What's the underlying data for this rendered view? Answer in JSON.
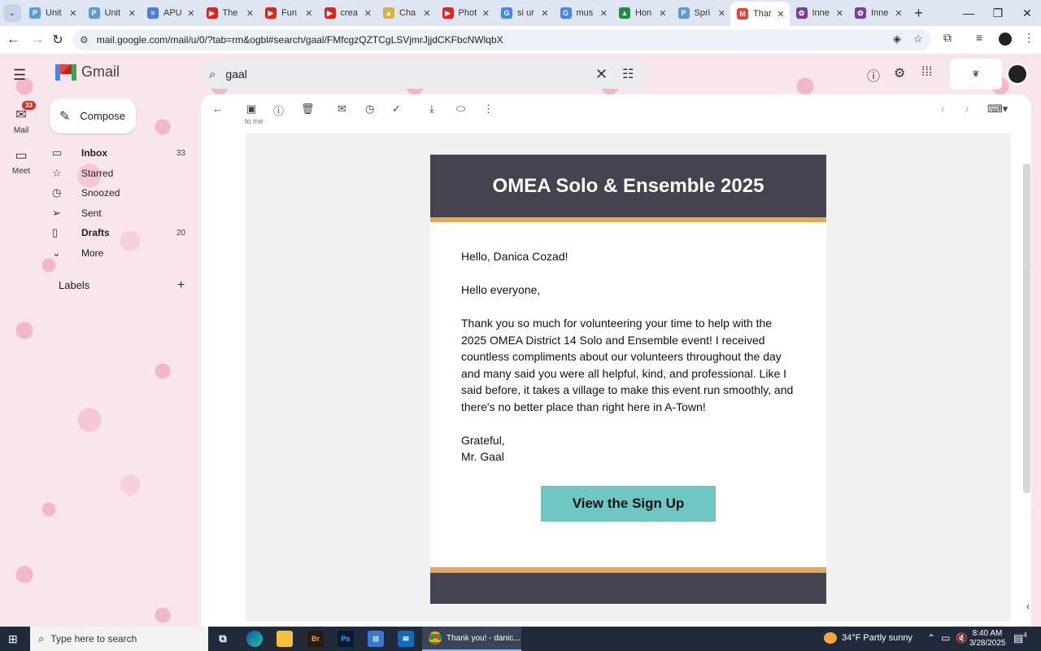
{
  "browser": {
    "tabs": [
      {
        "label": "Unit",
        "fav": "P",
        "color": "#5b9bd5"
      },
      {
        "label": "Unit",
        "fav": "P",
        "color": "#5b9bd5"
      },
      {
        "label": "APU",
        "fav": "≡",
        "color": "#4a7fd8"
      },
      {
        "label": "The",
        "fav": "▶",
        "color": "#e62117"
      },
      {
        "label": "Fun",
        "fav": "▶",
        "color": "#e62117"
      },
      {
        "label": "crea",
        "fav": "▶",
        "color": "#e62117"
      },
      {
        "label": "Cha",
        "fav": "▲",
        "color": "#d4b43a"
      },
      {
        "label": "Phot",
        "fav": "▶",
        "color": "#e62117"
      },
      {
        "label": "si ur",
        "fav": "G",
        "color": "#4285f4"
      },
      {
        "label": "mus",
        "fav": "G",
        "color": "#4285f4"
      },
      {
        "label": "Hon",
        "fav": "▲",
        "color": "#1e8e3e"
      },
      {
        "label": "Spri",
        "fav": "P",
        "color": "#5b9bd5"
      },
      {
        "label": "Thar",
        "fav": "M",
        "color": "#ea4335"
      },
      {
        "label": "Inne",
        "fav": "✿",
        "color": "#7a3aa8"
      },
      {
        "label": "Inne",
        "fav": "✿",
        "color": "#7a3aa8"
      }
    ],
    "url": "mail.google.com/mail/u/0/?tab=rm&ogbl#search/gaal/FMfcgzQZTCgLSVjmrJjjdCKFbcNWlqbX"
  },
  "gmail": {
    "logo_text": "Gmail",
    "search_value": "gaal",
    "rail": {
      "mail_label": "Mail",
      "mail_badge": "33",
      "meet_label": "Meet"
    },
    "compose_label": "Compose",
    "nav": [
      {
        "label": "Inbox",
        "count": "33",
        "icon": "inbox-icon",
        "glyph": "▭",
        "bold": true
      },
      {
        "label": "Starred",
        "count": "",
        "icon": "star-icon",
        "glyph": "☆",
        "bold": false
      },
      {
        "label": "Snoozed",
        "count": "",
        "icon": "clock-icon",
        "glyph": "◷",
        "bold": false
      },
      {
        "label": "Sent",
        "count": "",
        "icon": "send-icon",
        "glyph": "➢",
        "bold": false
      },
      {
        "label": "Drafts",
        "count": "20",
        "icon": "draft-icon",
        "glyph": "▯",
        "bold": true
      },
      {
        "label": "More",
        "count": "",
        "icon": "chevron-down-icon",
        "glyph": "⌄",
        "bold": false
      }
    ],
    "labels_header": "Labels",
    "sender_stub": "to me"
  },
  "email": {
    "title": "OMEA Solo & Ensemble 2025",
    "greeting": "Hello, Danica Cozad!",
    "intro": "Hello everyone,",
    "body": "Thank you so much for volunteering your time to help with the 2025 OMEA District 14 Solo and Ensemble event! I received countless compliments about our volunteers throughout the day and many said you were all helpful, kind, and professional. Like I said before, it takes a village to make this event run smoothly, and there's no better place than right here in A-Town!",
    "signoff": "Grateful,",
    "signature": "Mr. Gaal",
    "cta": "View the Sign Up"
  },
  "taskbar": {
    "search_placeholder": "Type here to search",
    "chrome_title": "Thank you! - danic...",
    "weather": "34°F  Partly sunny",
    "time": "8:40 AM",
    "date": "3/28/2025",
    "notif_count": "4"
  }
}
